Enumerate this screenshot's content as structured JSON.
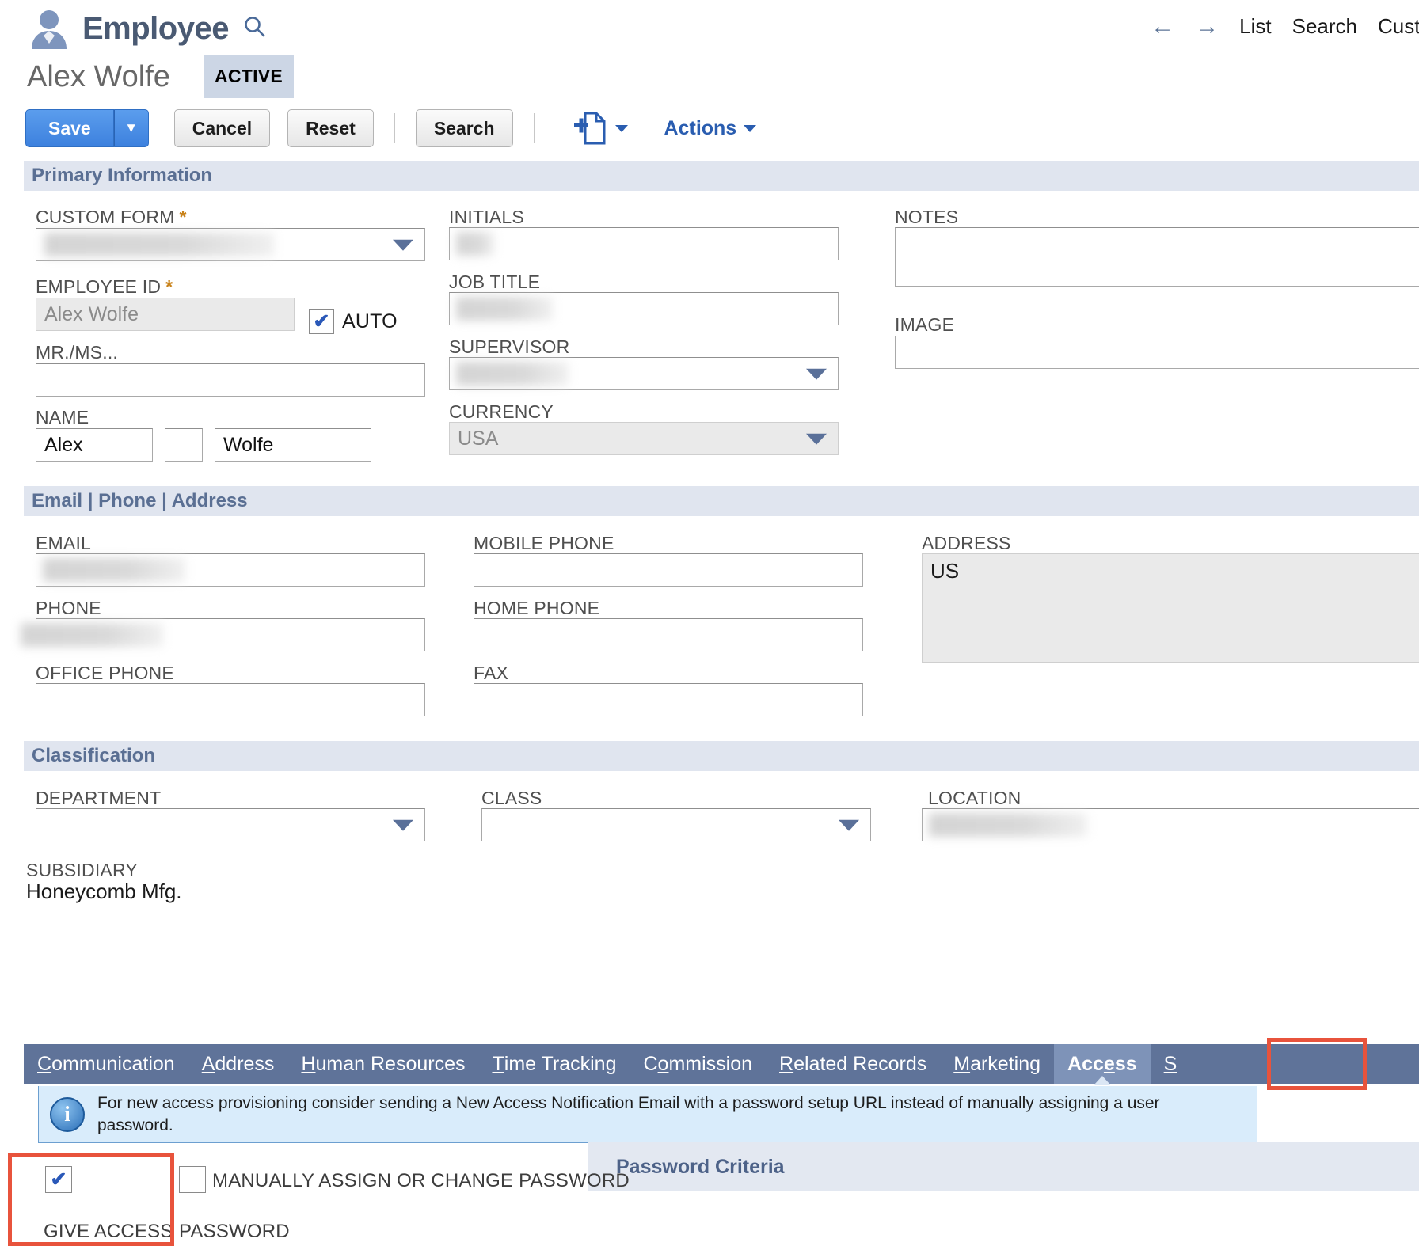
{
  "header": {
    "record_type": "Employee",
    "search_icon": "search-icon",
    "employee_name": "Alex Wolfe",
    "status": "ACTIVE",
    "nav": {
      "back_icon": "arrow-left-icon",
      "forward_icon": "arrow-right-icon",
      "links": [
        "List",
        "Search",
        "Cust"
      ]
    }
  },
  "toolbar": {
    "save_label": "Save",
    "save_dropdown_icon": "chevron-down-icon",
    "cancel_label": "Cancel",
    "reset_label": "Reset",
    "search_label": "Search",
    "new_doc_icon": "new-document-icon",
    "new_doc_caret_icon": "chevron-down-icon",
    "actions_label": "Actions",
    "actions_caret_icon": "chevron-down-icon"
  },
  "sections": {
    "primary": {
      "title": "Primary Information",
      "custom_form": {
        "label": "CUSTOM FORM",
        "required": "*",
        "value": "",
        "redacted": true
      },
      "employee_id": {
        "label": "EMPLOYEE ID",
        "required": "*",
        "value": "Alex Wolfe",
        "disabled": true
      },
      "auto_label": "AUTO",
      "auto_checked": true,
      "salutation": {
        "label": "MR./MS...",
        "value": ""
      },
      "name": {
        "label": "NAME",
        "first": "Alex",
        "middle": "",
        "last": "Wolfe"
      },
      "initials": {
        "label": "INITIALS",
        "value": "",
        "redacted": true
      },
      "job_title": {
        "label": "JOB TITLE",
        "value": "",
        "redacted": true
      },
      "supervisor": {
        "label": "SUPERVISOR",
        "value": "",
        "redacted": true
      },
      "currency": {
        "label": "CURRENCY",
        "value": "USA",
        "disabled": true
      },
      "notes": {
        "label": "NOTES",
        "value": ""
      },
      "image": {
        "label": "IMAGE",
        "value": ""
      }
    },
    "contact": {
      "title": "Email | Phone | Address",
      "email": {
        "label": "EMAIL",
        "value": "",
        "redacted": true
      },
      "phone": {
        "label": "PHONE",
        "value": "",
        "redacted": true
      },
      "office_phone": {
        "label": "OFFICE PHONE",
        "value": ""
      },
      "mobile_phone": {
        "label": "MOBILE PHONE",
        "value": ""
      },
      "home_phone": {
        "label": "HOME PHONE",
        "value": ""
      },
      "fax": {
        "label": "FAX",
        "value": ""
      },
      "address": {
        "label": "ADDRESS",
        "value": "US",
        "disabled": true
      }
    },
    "classification": {
      "title": "Classification",
      "department": {
        "label": "DEPARTMENT",
        "value": ""
      },
      "class": {
        "label": "CLASS",
        "value": ""
      },
      "location": {
        "label": "LOCATION",
        "value": "",
        "redacted": true
      },
      "subsidiary": {
        "label": "SUBSIDIARY",
        "value": "Honeycomb Mfg."
      }
    }
  },
  "tabs": [
    {
      "label": "Communication",
      "accesskey": "C",
      "pre": "",
      "post": "ommunication",
      "active": false
    },
    {
      "label": "Address",
      "accesskey": "A",
      "pre": "",
      "post": "ddress",
      "active": false
    },
    {
      "label": "Human Resources",
      "accesskey": "H",
      "pre": "",
      "post": "uman Resources",
      "active": false
    },
    {
      "label": "Time Tracking",
      "accesskey": "T",
      "pre": "",
      "post": "ime Tracking",
      "active": false
    },
    {
      "label": "Commission",
      "accesskey": "o",
      "pre": "C",
      "post": "mmission",
      "active": false
    },
    {
      "label": "Related Records",
      "accesskey": "R",
      "pre": "",
      "post": "elated Records",
      "active": false
    },
    {
      "label": "Marketing",
      "accesskey": "M",
      "pre": "",
      "post": "arketing",
      "active": false
    },
    {
      "label": "Access",
      "accesskey": "e",
      "pre": "Acc",
      "post": "ss",
      "active": true
    },
    {
      "label": "S",
      "accesskey": "S",
      "pre": "",
      "post": "",
      "active": false
    }
  ],
  "access": {
    "info_icon": "info-icon",
    "info_text": "For new access provisioning consider sending a New Access Notification Email with a password setup URL instead of manually assigning a user password.",
    "give_access_label": "GIVE ACCESS",
    "give_access_checked": true,
    "manual_password_label": "MANUALLY ASSIGN OR CHANGE PASSWORD",
    "manual_password_checked": false,
    "password_label": "PASSWORD",
    "password_criteria_title": "Password Criteria"
  },
  "highlights": {
    "accent_red": "#e8533c",
    "tab_bar_bg": "#5f7399",
    "section_bg": "#e0e5ef",
    "save_blue": "#3d81de"
  }
}
